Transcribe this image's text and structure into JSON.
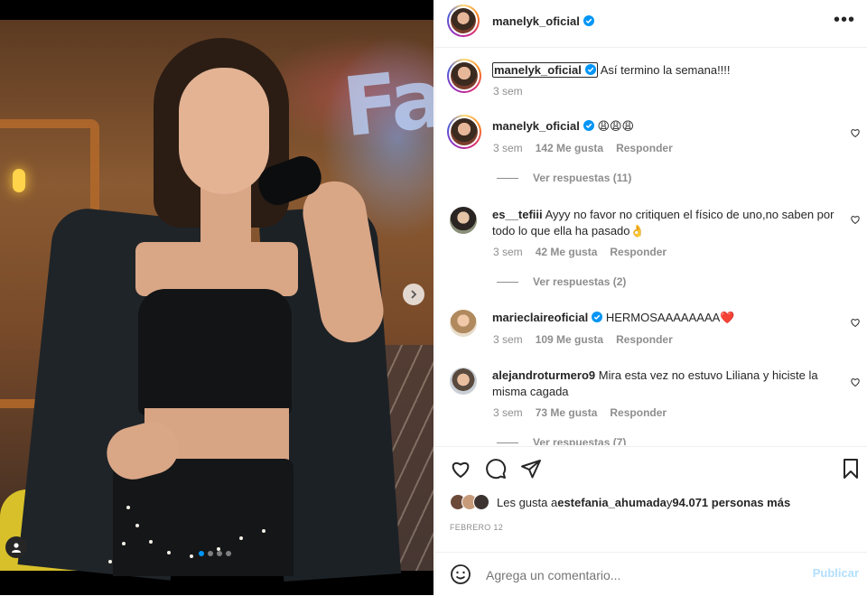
{
  "post": {
    "username": "manelyk_oficial",
    "caption": "Así termino la semana!!!!",
    "caption_time": "3 sem"
  },
  "header": {
    "more_label": "•••"
  },
  "comments": [
    {
      "username": "manelyk_oficial",
      "verified": true,
      "text": "😩😩😩",
      "time": "3 sem",
      "likes": "142 Me gusta",
      "reply": "Responder",
      "view_replies": "Ver respuestas (11)"
    },
    {
      "username": "es__tefiii",
      "verified": false,
      "text": "Ayyy no favor no critiquen el físico de uno,no saben por todo lo que ella ha pasado👌",
      "time": "3 sem",
      "likes": "42 Me gusta",
      "reply": "Responder",
      "view_replies": "Ver respuestas (2)"
    },
    {
      "username": "marieclaireoficial",
      "verified": true,
      "text": "HERMOSAAAAAAAA❤️",
      "time": "3 sem",
      "likes": "109 Me gusta",
      "reply": "Responder"
    },
    {
      "username": "alejandroturmero9",
      "verified": false,
      "text": "Mira esta vez no estuvo Liliana y hiciste la misma cagada",
      "time": "3 sem",
      "likes": "73 Me gusta",
      "reply": "Responder",
      "view_replies": "Ver respuestas (7)"
    }
  ],
  "likes": {
    "prefix": "Les gusta a ",
    "user": "estefania_ahumada",
    "mid": " y ",
    "count": "94.071 personas más"
  },
  "date": "FEBRERO 12",
  "comment_box": {
    "placeholder": "Agrega un comentario...",
    "publish": "Publicar"
  },
  "carousel": {
    "slides": 4,
    "active": 1
  },
  "photo_sign": "Fa",
  "colors": {
    "accent": "#0095f6",
    "heart": "#ed4956",
    "muted": "#8e8e8e",
    "publish_disabled": "#b2dffc"
  }
}
